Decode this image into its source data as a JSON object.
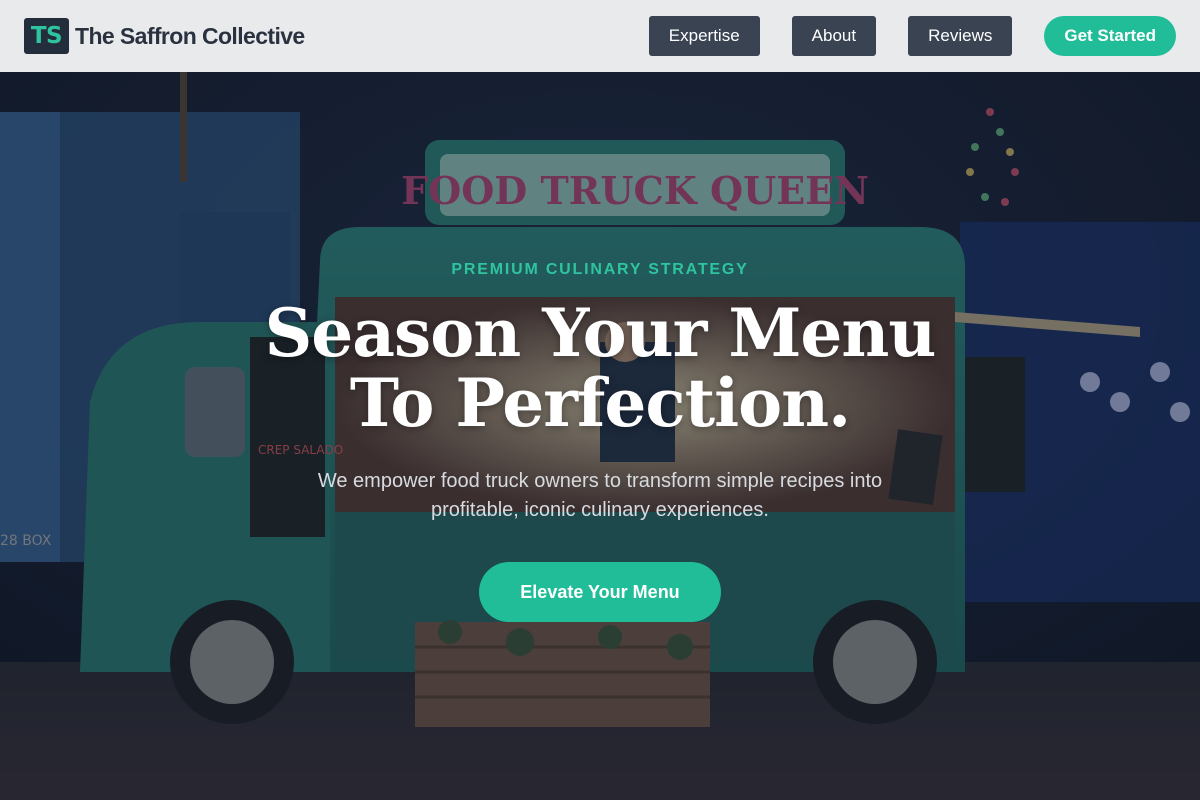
{
  "header": {
    "logo_initials": "TS",
    "brand_name": "The Saffron Collective",
    "nav": [
      {
        "label": "Expertise"
      },
      {
        "label": "About"
      },
      {
        "label": "Reviews"
      }
    ],
    "cta_label": "Get Started"
  },
  "hero": {
    "background_image": {
      "sign_text": "FOOD TRUCK QUEEN",
      "plate_text": "28 BOX",
      "menu_board_text": "CREP SALADO"
    },
    "eyebrow": "PREMIUM CULINARY STRATEGY",
    "headline_line1": "Season Your Menu",
    "headline_line2": "To Perfection.",
    "subtext": "We empower food truck owners to transform simple recipes into profitable, iconic culinary experiences.",
    "cta_label": "Elevate Your Menu"
  },
  "colors": {
    "accent": "#20bd98",
    "header_bg": "#e9eaec",
    "nav_button_bg": "#3a4352",
    "dark": "#232d3b"
  }
}
